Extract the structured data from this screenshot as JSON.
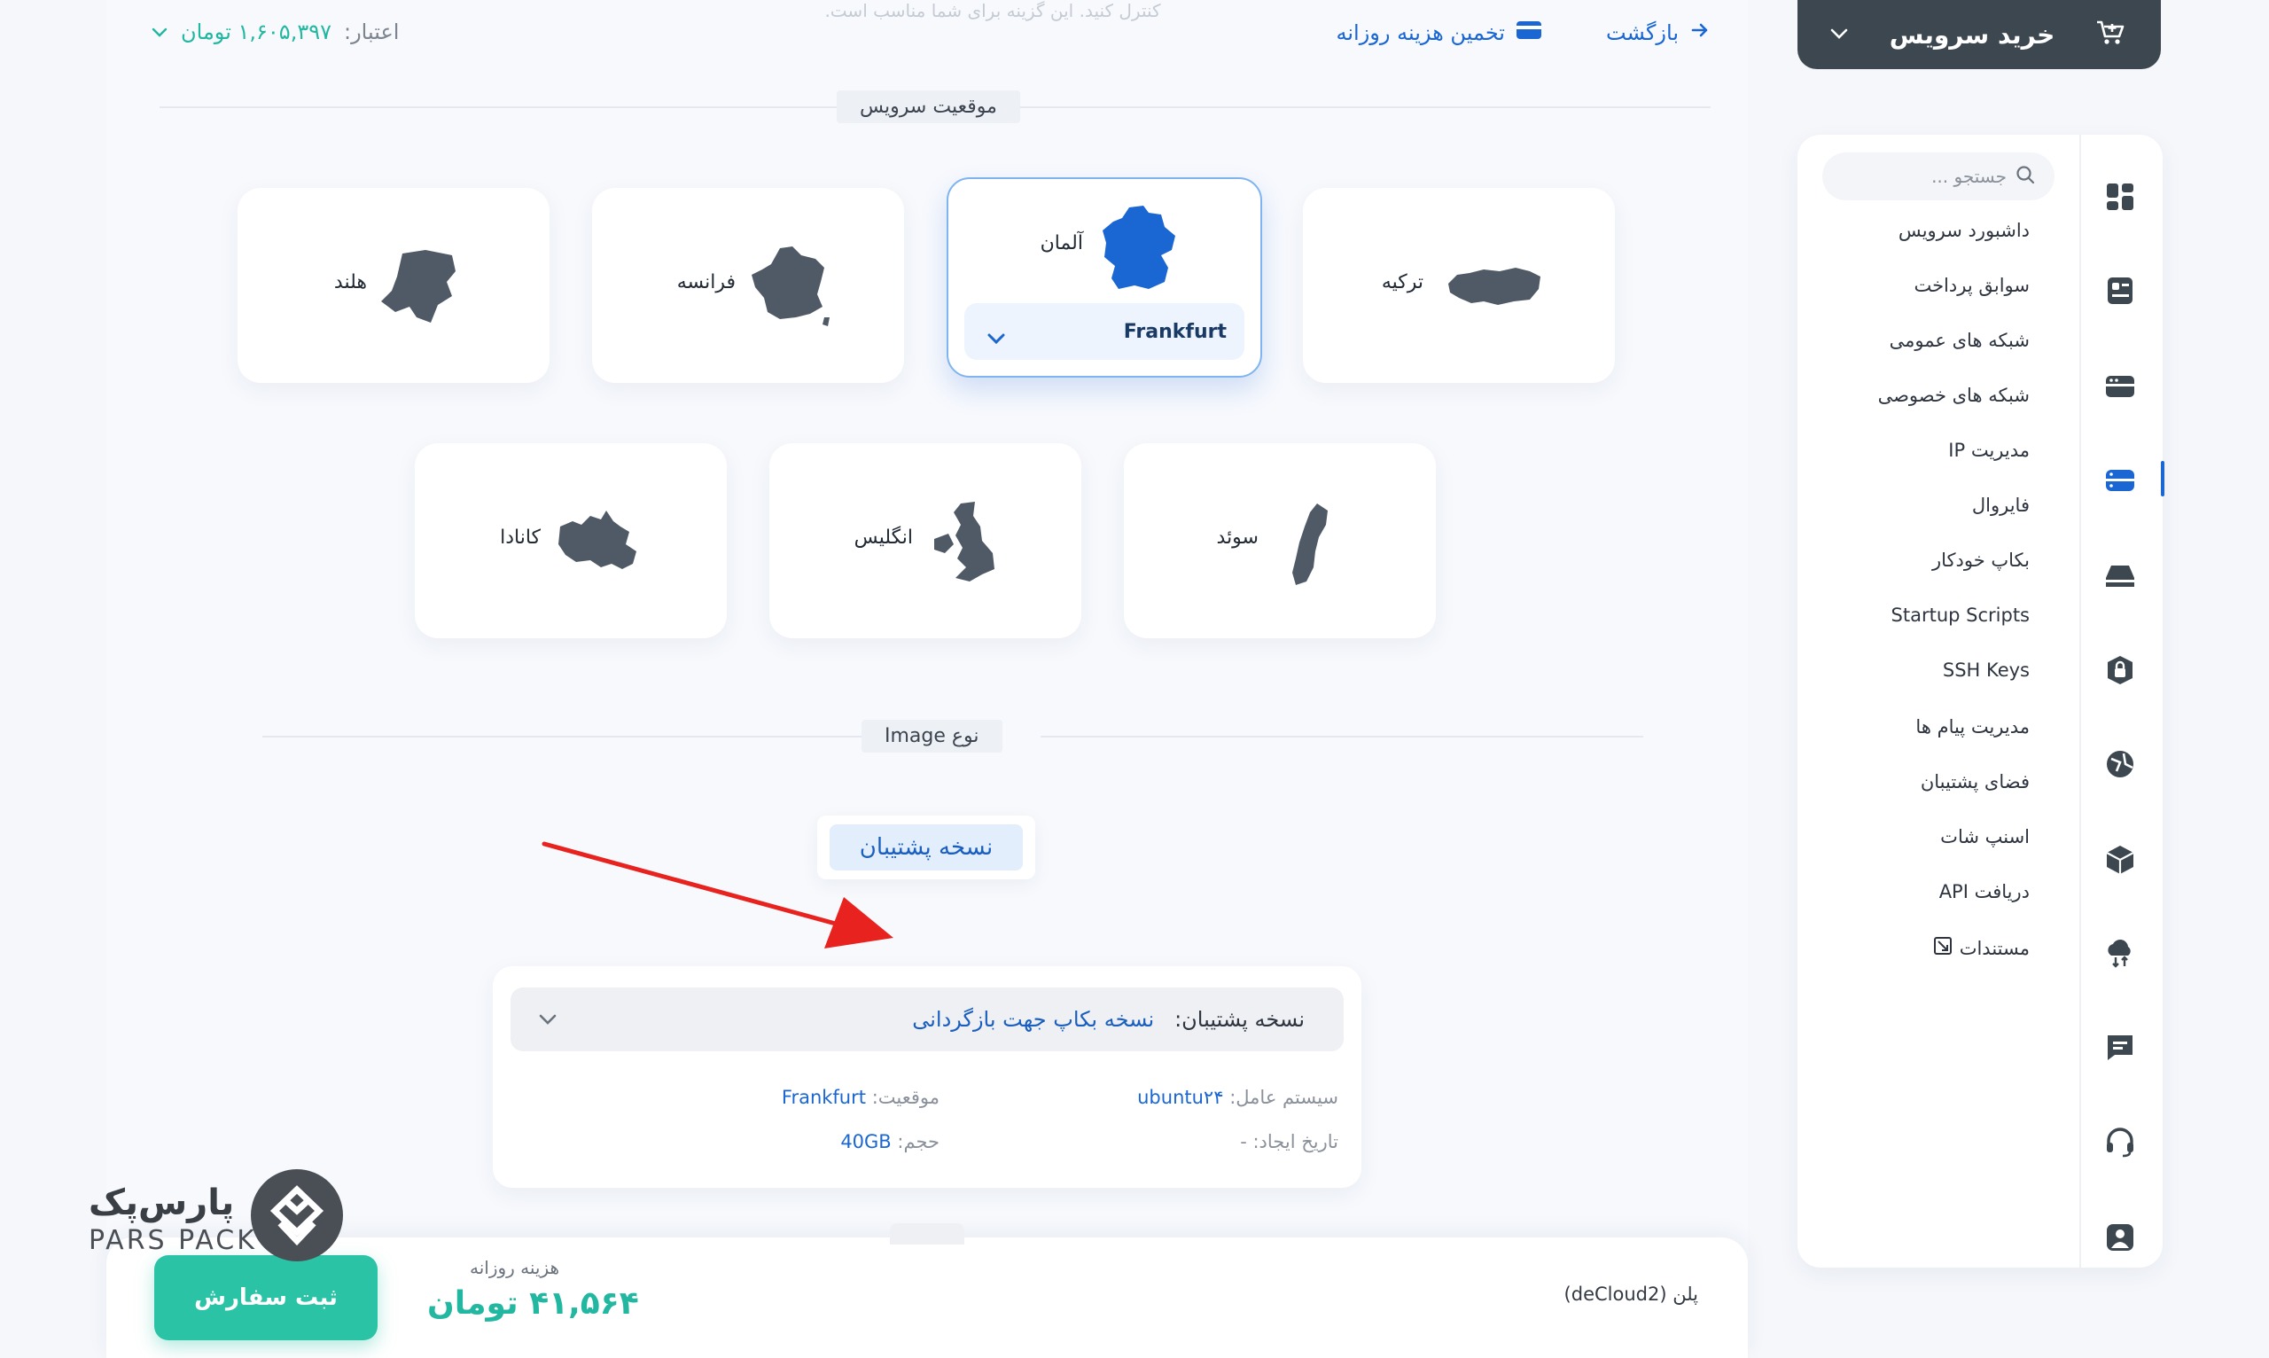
{
  "topbar": {
    "back": "بازگشت",
    "estimate": "تخمین هزینه روزانه",
    "faint_text": "کنترل کنید. این گزینه برای شما مناسب است.",
    "credit_label": "اعتبار:",
    "credit_value": "۱,۶۰۵,۳۹۷ تومان"
  },
  "location_section": {
    "label": "موقعیت سرویس",
    "countries": [
      {
        "name": "ترکیه",
        "icon": "turkey-map-icon"
      },
      {
        "name": "آلمان",
        "icon": "germany-map-icon",
        "selected": true,
        "city": "Frankfurt"
      },
      {
        "name": "فرانسه",
        "icon": "france-map-icon"
      },
      {
        "name": "هلند",
        "icon": "netherlands-map-icon"
      },
      {
        "name": "سوئد",
        "icon": "sweden-map-icon"
      },
      {
        "name": "انگلیس",
        "icon": "uk-map-icon"
      },
      {
        "name": "کانادا",
        "icon": "canada-map-icon"
      }
    ]
  },
  "image_section": {
    "label": "نوع Image",
    "tab": "نسخه پشتیبان"
  },
  "backup": {
    "select_key": "نسخه پشتیبان:",
    "select_value": "نسخه بکاپ جهت بازگردانی",
    "os_key": "سیستم عامل:",
    "os_value": "ubuntu۲۴",
    "location_key": "موقعیت:",
    "location_value": "Frankfurt",
    "created_key": "تاریخ ایجاد:",
    "created_value": "-",
    "size_key": "حجم:",
    "size_value": "40GB"
  },
  "bottom": {
    "plan": "پلن (deCloud2)",
    "daily_label": "هزینه روزانه",
    "daily_price": "۴۱,۵۶۴ تومان",
    "order_button": "ثبت سفارش"
  },
  "logo": {
    "fa": "پارس‌پک",
    "en": "PARS PACK"
  },
  "sidebar": {
    "buy_service": "خرید سرویس",
    "search_placeholder": "جستجو ...",
    "items": [
      "داشبورد سرویس",
      "سوابق پرداخت",
      "شبکه های عمومی",
      "شبکه های خصوصی",
      "مدیریت IP",
      "فایروال",
      "بکاپ خودکار",
      "Startup Scripts",
      "SSH Keys",
      "مدیریت پیام ها",
      "فضای پشتیبان",
      "اسنپ شات",
      "دریافت API",
      "مستندات"
    ]
  },
  "colors": {
    "accent": "#1a66d2",
    "teal": "#2bc3a6",
    "dark": "#3c4750",
    "map": "#4f5a66",
    "map_selected": "#1a66d2",
    "arrow": "#e8231f"
  }
}
